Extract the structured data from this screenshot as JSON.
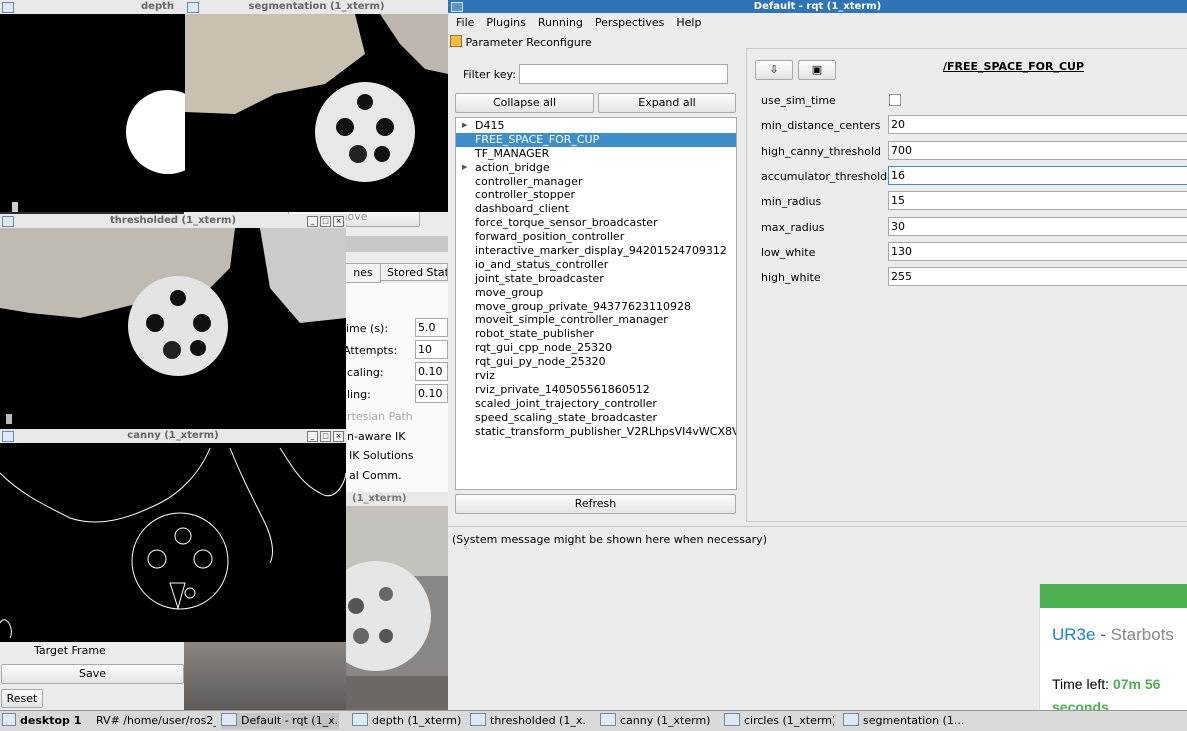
{
  "windows": {
    "depth_title": "depth (1_x",
    "segmentation_title": "segmentation (1_xterm)",
    "thresholded_title": "thresholded (1_xterm)",
    "canny_title": "canny (1_xterm)",
    "circles_title": "(1_xterm)"
  },
  "background_panel": {
    "tabs": [
      "nes",
      "Stored Stat"
    ],
    "rows": [
      {
        "label": "ime (s):",
        "value": "5.0"
      },
      {
        "label": "Attempts:",
        "value": "10"
      },
      {
        "label": "caling:",
        "value": "0.10"
      },
      {
        "label": "ling:",
        "value": "0.10"
      }
    ],
    "cartesian_path": "rtesian Path",
    "aware_ik": "n-aware IK",
    "ik_solutions": "IK Solutions",
    "comm": "al Comm.",
    "move_btn": "nove",
    "target_frame": "Target Frame",
    "save": "Save",
    "reset": "Reset"
  },
  "rqt": {
    "title": "Default - rqt (1_xterm)",
    "menu": [
      "File",
      "Plugins",
      "Running",
      "Perspectives",
      "Help"
    ],
    "plugin_title": "Parameter Reconfigure",
    "filter_label": "Filter key:",
    "filter_value": "",
    "collapse_all": "Collapse all",
    "expand_all": "Expand all",
    "refresh": "Refresh",
    "nodes": [
      {
        "name": "D415",
        "expandable": true,
        "selected": false
      },
      {
        "name": "FREE_SPACE_FOR_CUP",
        "expandable": false,
        "selected": true
      },
      {
        "name": "TF_MANAGER",
        "expandable": false,
        "selected": false
      },
      {
        "name": "action_bridge",
        "expandable": true,
        "selected": false
      },
      {
        "name": "controller_manager",
        "expandable": false,
        "selected": false
      },
      {
        "name": "controller_stopper",
        "expandable": false,
        "selected": false
      },
      {
        "name": "dashboard_client",
        "expandable": false,
        "selected": false
      },
      {
        "name": "force_torque_sensor_broadcaster",
        "expandable": false,
        "selected": false
      },
      {
        "name": "forward_position_controller",
        "expandable": false,
        "selected": false
      },
      {
        "name": "interactive_marker_display_94201524709312",
        "expandable": false,
        "selected": false
      },
      {
        "name": "io_and_status_controller",
        "expandable": false,
        "selected": false
      },
      {
        "name": "joint_state_broadcaster",
        "expandable": false,
        "selected": false
      },
      {
        "name": "move_group",
        "expandable": false,
        "selected": false
      },
      {
        "name": "move_group_private_94377623110928",
        "expandable": false,
        "selected": false
      },
      {
        "name": "moveit_simple_controller_manager",
        "expandable": false,
        "selected": false
      },
      {
        "name": "robot_state_publisher",
        "expandable": false,
        "selected": false
      },
      {
        "name": "rqt_gui_cpp_node_25320",
        "expandable": false,
        "selected": false
      },
      {
        "name": "rqt_gui_py_node_25320",
        "expandable": false,
        "selected": false
      },
      {
        "name": "rviz",
        "expandable": false,
        "selected": false
      },
      {
        "name": "rviz_private_140505561860512",
        "expandable": false,
        "selected": false
      },
      {
        "name": "scaled_joint_trajectory_controller",
        "expandable": false,
        "selected": false
      },
      {
        "name": "speed_scaling_state_broadcaster",
        "expandable": false,
        "selected": false
      },
      {
        "name": "static_transform_publisher_V2RLhpsVI4vWCX8V",
        "expandable": false,
        "selected": false
      }
    ],
    "node_title": "/FREE_SPACE_FOR_CUP",
    "params": [
      {
        "name": "use_sim_time",
        "type": "checkbox",
        "value": ""
      },
      {
        "name": "min_distance_centers",
        "type": "text",
        "value": "20"
      },
      {
        "name": "high_canny_threshold",
        "type": "text",
        "value": "700"
      },
      {
        "name": "accumulator_threshold",
        "type": "text",
        "value": "16"
      },
      {
        "name": "min_radius",
        "type": "text",
        "value": "15"
      },
      {
        "name": "max_radius",
        "type": "text",
        "value": "30"
      },
      {
        "name": "low_white",
        "type": "text",
        "value": "130"
      },
      {
        "name": "high_white",
        "type": "text",
        "value": "255"
      }
    ],
    "system_message": "(System message might be shown here when necessary)"
  },
  "overlay": {
    "brand_a": "UR3e",
    "brand_sep": " - ",
    "brand_b": "Starbots",
    "time_label": "Time left: ",
    "time_value": "07m 56",
    "time_unit": "seconds",
    "accent": "#4caf50"
  },
  "taskbar": {
    "desktop": "desktop 1",
    "items": [
      "RV# /home/user/ros2_...",
      "Default - rqt (1_x...",
      "depth (1_xterm)",
      "thresholded (1_x...",
      "canny (1_xterm)",
      "circles (1_xterm)",
      "segmentation (1..."
    ]
  }
}
